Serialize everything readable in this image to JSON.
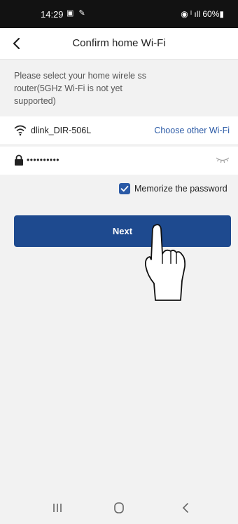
{
  "status_bar": {
    "time": "14:29",
    "left_icons": "▣ ✎",
    "right_icons": "◉ ᴵ ıll 60%▮"
  },
  "header": {
    "title": "Confirm home Wi-Fi"
  },
  "instructions": "Please select your home wirele ss router(5GHz Wi-Fi is not yet supported)",
  "wifi": {
    "ssid": "dlink_DIR-506L",
    "choose_label": "Choose other Wi-Fi"
  },
  "password": {
    "value": "••••••••••"
  },
  "memorize": {
    "label": "Memorize the password",
    "checked": true
  },
  "next_button": {
    "label": "Next"
  },
  "colors": {
    "accent": "#1e4a8f",
    "link": "#2b5aa6"
  },
  "icons": [
    "back-chevron-icon",
    "wifi-icon",
    "lock-icon",
    "eye-closed-icon",
    "checkmark-icon",
    "pointer-hand-icon",
    "recents-icon",
    "home-icon",
    "back-nav-icon"
  ]
}
